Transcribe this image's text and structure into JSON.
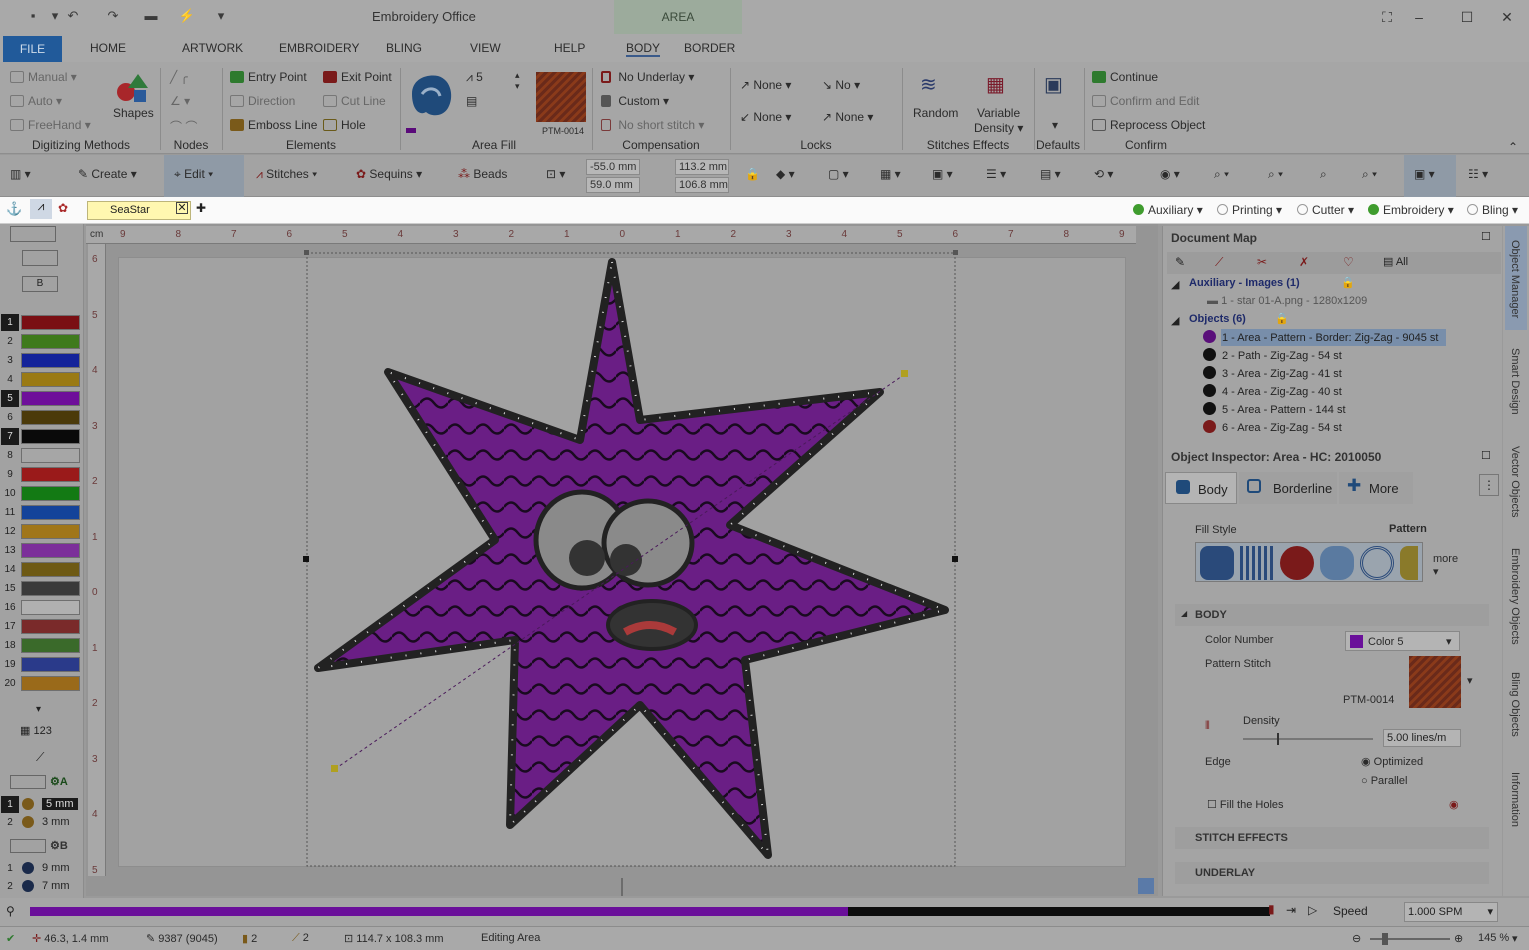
{
  "titlebar": {
    "app_title": "Embroidery Office",
    "context_tab": "AREA"
  },
  "tabs": [
    "FILE",
    "HOME",
    "ARTWORK",
    "EMBROIDERY",
    "BLING",
    "VIEW",
    "HELP",
    "BODY",
    "BORDER"
  ],
  "ribbon": {
    "digitizing": {
      "manual": "Manual",
      "auto": "Auto",
      "freehand": "FreeHand",
      "shapes": "Shapes",
      "label": "Digitizing Methods"
    },
    "nodes": {
      "label": "Nodes"
    },
    "elements": {
      "entry": "Entry Point",
      "exit": "Exit Point",
      "direction": "Direction",
      "cutline": "Cut Line",
      "emboss": "Emboss Line",
      "hole": "Hole",
      "label": "Elements"
    },
    "areafill": {
      "count": "5",
      "pattern": "PTM-0014",
      "label": "Area Fill"
    },
    "compensation": {
      "underlay": "No Underlay",
      "custom": "Custom",
      "short": "No short stitch",
      "label": "Compensation"
    },
    "locks": {
      "a": "None",
      "b": "No",
      "c": "None",
      "d": "None",
      "label": "Locks"
    },
    "stitch_effects": {
      "random": "Random",
      "variable": "Variable",
      "density": "Density",
      "label": "Stitches Effects"
    },
    "defaults": {
      "label": "Defaults"
    },
    "confirm": {
      "continue": "Continue",
      "confirm_edit": "Confirm and Edit",
      "reprocess": "Reprocess Object",
      "label": "Confirm"
    }
  },
  "toolbar2": {
    "create": "Create",
    "edit": "Edit",
    "stitches": "Stitches",
    "sequins": "Sequins",
    "beads": "Beads",
    "x": "-55.0 mm",
    "y": "59.0 mm",
    "w": "113.2 mm",
    "h": "106.8 mm"
  },
  "document": {
    "tab": "SeaStar"
  },
  "visibility": [
    {
      "label": "Auxiliary",
      "color": "#3f9c2e"
    },
    {
      "label": "Printing",
      "color": "#bdbdbd"
    },
    {
      "label": "Cutter",
      "color": "#bdbdbd"
    },
    {
      "label": "Embroidery",
      "color": "#3f9c2e"
    },
    {
      "label": "Bling",
      "color": "#bdbdbd"
    }
  ],
  "leftbar": {
    "b_label": "B",
    "colors": [
      {
        "n": "1",
        "c": "#7a0f14"
      },
      {
        "n": "2",
        "c": "#3f7a1c"
      },
      {
        "n": "3",
        "c": "#14239a"
      },
      {
        "n": "4",
        "c": "#9a7a14"
      },
      {
        "n": "5",
        "c": "#6e0f9a"
      },
      {
        "n": "6",
        "c": "#4b3a0a"
      },
      {
        "n": "7",
        "c": "#0a0a0a"
      },
      {
        "n": "8",
        "c": "#a6a6a6"
      },
      {
        "n": "9",
        "c": "#9a1a1a"
      },
      {
        "n": "10",
        "c": "#137a14"
      },
      {
        "n": "11",
        "c": "#14439a"
      },
      {
        "n": "12",
        "c": "#a0761a"
      },
      {
        "n": "13",
        "c": "#7c2f9a"
      },
      {
        "n": "14",
        "c": "#6e5a14"
      },
      {
        "n": "15",
        "c": "#3a3a3a"
      },
      {
        "n": "16",
        "c": "#b0b0b0"
      },
      {
        "n": "17",
        "c": "#7a2a2a"
      },
      {
        "n": "18",
        "c": "#3a6a2a"
      },
      {
        "n": "19",
        "c": "#2a3a8a"
      },
      {
        "n": "20",
        "c": "#9a6a1a"
      }
    ],
    "seq_a": "A",
    "seq_b": "B",
    "sizes_a": [
      {
        "n": "1",
        "v": "5 mm"
      },
      {
        "n": "2",
        "v": "3 mm"
      }
    ],
    "sizes_b": [
      {
        "n": "1",
        "v": "9 mm"
      },
      {
        "n": "2",
        "v": "7 mm"
      }
    ],
    "num_label": "123"
  },
  "ruler_top": [
    "9",
    "8",
    "7",
    "6",
    "5",
    "4",
    "3",
    "2",
    "1",
    "0",
    "1",
    "2",
    "3",
    "4",
    "5",
    "6",
    "7",
    "8",
    "9"
  ],
  "ruler_left": [
    "6",
    "5",
    "4",
    "3",
    "2",
    "1",
    "0",
    "1",
    "2",
    "3",
    "4",
    "5"
  ],
  "ruler_unit": "cm",
  "document_map": {
    "title": "Document Map",
    "all": "All",
    "aux_group": "Auxiliary - Images (1)",
    "aux_item": "1 - star 01-A.png - 1280x1209",
    "obj_group": "Objects (6)",
    "objects": [
      "1 - Area - Pattern - Border: Zig-Zag - 9045 st",
      "2 - Path - Zig-Zag - 54 st",
      "3 - Area - Zig-Zag - 41 st",
      "4 - Area - Zig-Zag - 40 st",
      "5 - Area - Pattern - 144 st",
      "6 - Area - Zig-Zag - 54 st"
    ]
  },
  "inspector": {
    "title": "Object Inspector: Area - HC: 2010050",
    "tabs": [
      "Body",
      "Borderline",
      "More"
    ],
    "fill_style": "Fill Style",
    "fill_value": "Pattern",
    "more": "more",
    "body_section": "BODY",
    "color_number": "Color Number",
    "color_value": "Color 5",
    "pattern_stitch": "Pattern Stitch",
    "pattern_name": "PTM-0014",
    "density": "Density",
    "density_value": "5.00 lines/m",
    "edge": "Edge",
    "optimized": "Optimized",
    "parallel": "Parallel",
    "fill_holes": "Fill the Holes",
    "stitch_effects": "STITCH EFFECTS",
    "underlay": "UNDERLAY"
  },
  "vtabs": [
    "Object Manager",
    "Smart Design",
    "Vector Objects",
    "Embroidery Objects",
    "Bling Objects",
    "Information"
  ],
  "timeline": {
    "speed_label": "Speed",
    "speed_value": "1.000 SPM",
    "progress": 0.66
  },
  "status": {
    "coords": "46.3, 1.4 mm",
    "stitches": "9387 (9045)",
    "a": "2",
    "b": "2",
    "size": "114.7 x 108.3 mm",
    "mode": "Editing Area",
    "zoom": "145 %"
  }
}
